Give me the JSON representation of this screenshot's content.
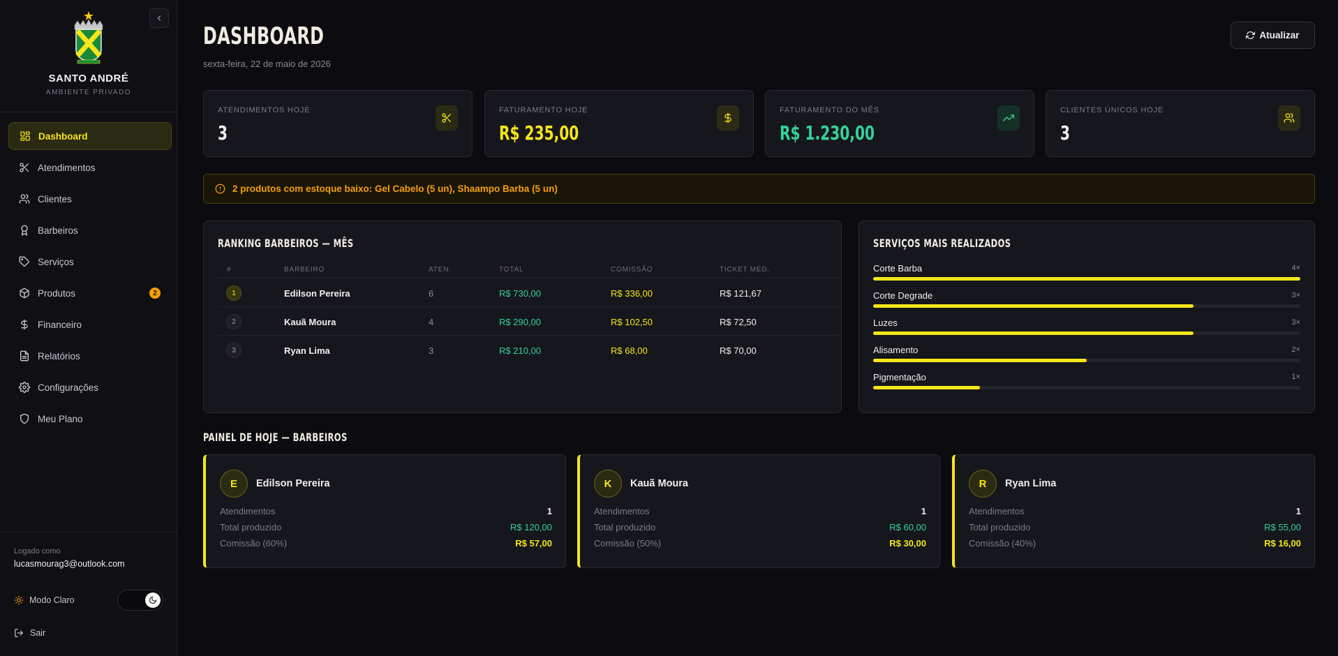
{
  "sidebar": {
    "brand_name": "SANTO ANDRÉ",
    "brand_sub": "AMBIENTE PRIVADO",
    "crest_text": "E.C. SANTO ANDRÉ",
    "nav": [
      {
        "label": "Dashboard",
        "icon": "dashboard-icon",
        "active": true
      },
      {
        "label": "Atendimentos",
        "icon": "scissors-icon"
      },
      {
        "label": "Clientes",
        "icon": "users-icon"
      },
      {
        "label": "Barbeiros",
        "icon": "award-icon"
      },
      {
        "label": "Serviços",
        "icon": "tag-icon"
      },
      {
        "label": "Produtos",
        "icon": "package-icon",
        "badge": "2"
      },
      {
        "label": "Financeiro",
        "icon": "dollar-icon"
      },
      {
        "label": "Relatórios",
        "icon": "file-icon"
      },
      {
        "label": "Configurações",
        "icon": "gear-icon"
      },
      {
        "label": "Meu Plano",
        "icon": "shield-icon"
      }
    ],
    "logged_label": "Logado como",
    "logged_email": "lucasmourag3@outlook.com",
    "theme_label": "Modo Claro",
    "logout_label": "Sair"
  },
  "header": {
    "title": "DASHBOARD",
    "date": "sexta-feira, 22 de maio de 2026",
    "refresh_label": "Atualizar"
  },
  "stats": [
    {
      "label": "ATENDIMENTOS HOJE",
      "value": "3",
      "color": "#f0f0f0",
      "icon": "scissors-icon",
      "icon_color": "#f5e61a",
      "icon_bg": "#2b2a16"
    },
    {
      "label": "FATURAMENTO HOJE",
      "value": "R$ 235,00",
      "color": "#f5e61a",
      "icon": "dollar-icon",
      "icon_color": "#f5e61a",
      "icon_bg": "#2b2a16"
    },
    {
      "label": "FATURAMENTO DO MÊS",
      "value": "R$ 1.230,00",
      "color": "#34d399",
      "icon": "trending-up-icon",
      "icon_color": "#34d399",
      "icon_bg": "#163028"
    },
    {
      "label": "CLIENTES ÚNICOS HOJE",
      "value": "3",
      "color": "#f0f0f0",
      "icon": "users-icon",
      "icon_color": "#f5e61a",
      "icon_bg": "#2b2a16"
    }
  ],
  "alert": {
    "text": "2 produtos com estoque baixo: Gel Cabelo (5 un), Shaampo Barba (5 un)"
  },
  "ranking": {
    "title": "RANKING BARBEIROS — MÊS",
    "headers": [
      "#",
      "BARBEIRO",
      "ATEN.",
      "TOTAL",
      "COMISSÃO",
      "TICKET MÉD."
    ],
    "rows": [
      {
        "pos": "1",
        "name": "Edilson Pereira",
        "aten": "6",
        "total": "R$ 730,00",
        "comissao": "R$ 336,00",
        "ticket": "R$ 121,67"
      },
      {
        "pos": "2",
        "name": "Kauã Moura",
        "aten": "4",
        "total": "R$ 290,00",
        "comissao": "R$ 102,50",
        "ticket": "R$ 72,50"
      },
      {
        "pos": "3",
        "name": "Ryan Lima",
        "aten": "3",
        "total": "R$ 210,00",
        "comissao": "R$ 68,00",
        "ticket": "R$ 70,00"
      }
    ]
  },
  "services": {
    "title": "SERVIÇOS MAIS REALIZADOS",
    "items": [
      {
        "name": "Corte Barba",
        "count": "4×",
        "value": 4
      },
      {
        "name": "Corte Degrade",
        "count": "3×",
        "value": 3
      },
      {
        "name": "Luzes",
        "count": "3×",
        "value": 3
      },
      {
        "name": "Alisamento",
        "count": "2×",
        "value": 2
      },
      {
        "name": "Pigmentação",
        "count": "1×",
        "value": 1
      }
    ],
    "max": 4
  },
  "today_panel": {
    "title": "PAINEL DE HOJE — BARBEIROS",
    "barbers": [
      {
        "initial": "E",
        "name": "Edilson Pereira",
        "atendimentos_label": "Atendimentos",
        "atendimentos": "1",
        "total_label": "Total produzido",
        "total": "R$ 120,00",
        "comissao_label": "Comissão (60%)",
        "comissao": "R$ 57,00"
      },
      {
        "initial": "K",
        "name": "Kauã Moura",
        "atendimentos_label": "Atendimentos",
        "atendimentos": "1",
        "total_label": "Total produzido",
        "total": "R$ 60,00",
        "comissao_label": "Comissão (50%)",
        "comissao": "R$ 30,00"
      },
      {
        "initial": "R",
        "name": "Ryan Lima",
        "atendimentos_label": "Atendimentos",
        "atendimentos": "1",
        "total_label": "Total produzido",
        "total": "R$ 55,00",
        "comissao_label": "Comissão (40%)",
        "comissao": "R$ 16,00"
      }
    ]
  },
  "colors": {
    "accent": "#f5e61a",
    "green": "#34d399",
    "warning": "#f59e0b",
    "background": "#0c0c10",
    "card": "#16161d"
  }
}
